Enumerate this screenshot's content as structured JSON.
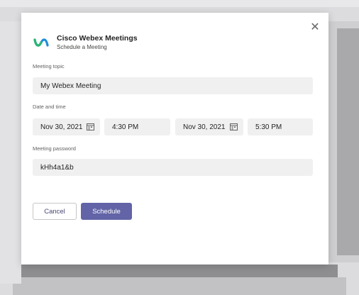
{
  "dialog": {
    "app_name": "Cisco Webex Meetings",
    "subtitle": "Schedule a Meeting",
    "close_glyph": "✕"
  },
  "form": {
    "topic_label": "Meeting topic",
    "topic_value": "My Webex Meeting",
    "datetime_label": "Date and time",
    "start_date": "Nov 30, 2021",
    "start_time": "4:30 PM",
    "end_date": "Nov 30, 2021",
    "end_time": "5:30 PM",
    "password_label": "Meeting password",
    "password_value": "kHh4a1&b"
  },
  "actions": {
    "cancel_label": "Cancel",
    "schedule_label": "Schedule"
  },
  "icons": {
    "logo": "webex-logo",
    "close": "close-icon",
    "calendar": "calendar-icon"
  },
  "colors": {
    "primary": "#6264a7",
    "field_bg": "#f0f0f0"
  }
}
